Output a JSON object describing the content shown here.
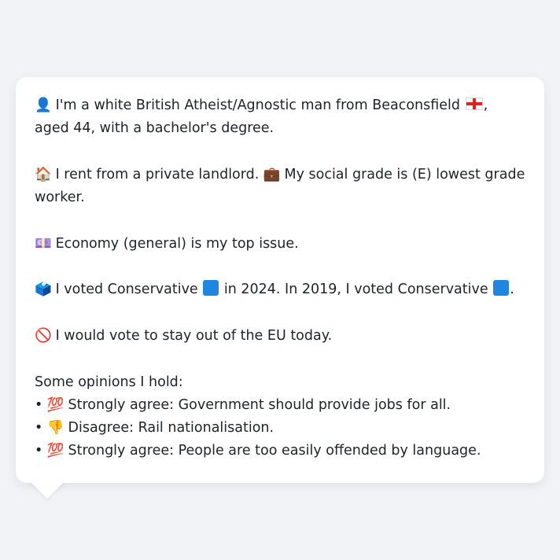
{
  "profile": {
    "line1_icon": "👤",
    "line1_text_a": "I'm a white British Atheist/Agnostic man from Beaconsfield",
    "line1_flag": "england-flag",
    "line1_text_b": ", aged 44, with a bachelor's degree.",
    "housing_icon": "🏠",
    "housing_text": "I rent from a private landlord.",
    "grade_icon": "💼",
    "grade_text": "My social grade is (E) lowest grade worker.",
    "issue_icon": "💷",
    "issue_text": "Economy (general) is my top issue.",
    "vote_icon": "🗳️",
    "vote_text_a": "I voted Conservative",
    "vote_text_b": "in 2024. In 2019, I voted Conservative",
    "vote_text_c": ".",
    "party_color": "#1f87e0",
    "eu_icon": "🚫",
    "eu_text": "I would vote to stay out of the EU today."
  },
  "opinions": {
    "heading": "Some opinions I hold:",
    "bullet": "•",
    "items": [
      {
        "icon": "💯",
        "text": "Strongly agree: Government should provide jobs for all."
      },
      {
        "icon": "👎",
        "text": "Disagree: Rail nationalisation."
      },
      {
        "icon": "💯",
        "text": "Strongly agree: People are too easily offended by language."
      }
    ]
  }
}
